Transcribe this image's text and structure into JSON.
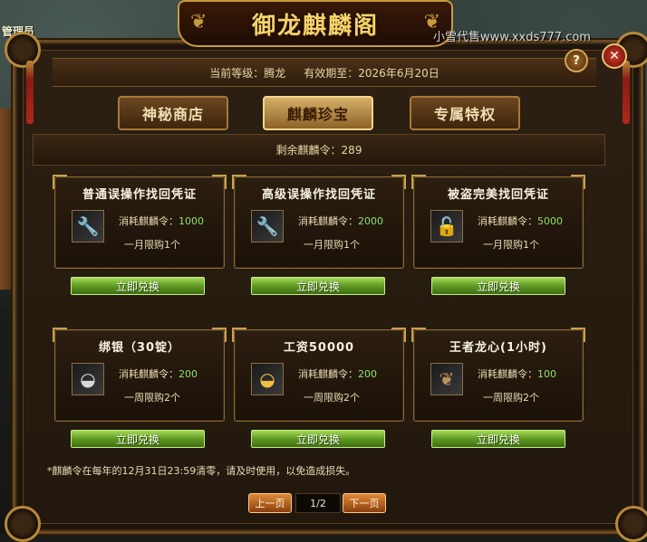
{
  "background": {
    "admin_label": "管理员"
  },
  "window": {
    "title": "御龙麒麟阁",
    "watermark": "小雪代售www.xxds777.com",
    "help_label": "?",
    "close_label": "✕"
  },
  "info": {
    "level": "当前等级：腾龙",
    "expiry": "有效期至：2026年6月20日"
  },
  "tabs": [
    {
      "label": "神秘商店",
      "active": false
    },
    {
      "label": "麒麟珍宝",
      "active": true
    },
    {
      "label": "专属特权",
      "active": false
    }
  ],
  "balance": "剩余麒麟令：289",
  "items": [
    {
      "title": "普通误操作找回凭证",
      "icon": "wrench-icon",
      "cost_label": "消耗麒麟令：",
      "cost": "1000",
      "limit": "一月限购1个",
      "button": "立即兑换"
    },
    {
      "title": "高级误操作找回凭证",
      "icon": "wrench-icon",
      "cost_label": "消耗麒麟令：",
      "cost": "2000",
      "limit": "一月限购1个",
      "button": "立即兑换"
    },
    {
      "title": "被盗完美找回凭证",
      "icon": "lock-icon",
      "cost_label": "消耗麒麟令：",
      "cost": "5000",
      "limit": "一月限购1个",
      "button": "立即兑换"
    },
    {
      "title": "绑银（30锭）",
      "icon": "silver-ingot-icon",
      "cost_label": "消耗麒麟令：",
      "cost": "200",
      "limit": "一周限购2个",
      "button": "立即兑换"
    },
    {
      "title": "工资50000",
      "icon": "gold-ingot-icon",
      "cost_label": "消耗麒麟令：",
      "cost": "200",
      "limit": "一周限购2个",
      "button": "立即兑换"
    },
    {
      "title": "王者龙心(1小时)",
      "icon": "dragon-heart-icon",
      "cost_label": "消耗麒麟令：",
      "cost": "100",
      "limit": "一周限购2个",
      "button": "立即兑换"
    }
  ],
  "footnote": "*麒麟令在每年的12月31日23:59清零，请及时使用，以免造成损失。",
  "pager": {
    "prev": "上一页",
    "page": "1/2",
    "next": "下一页"
  }
}
